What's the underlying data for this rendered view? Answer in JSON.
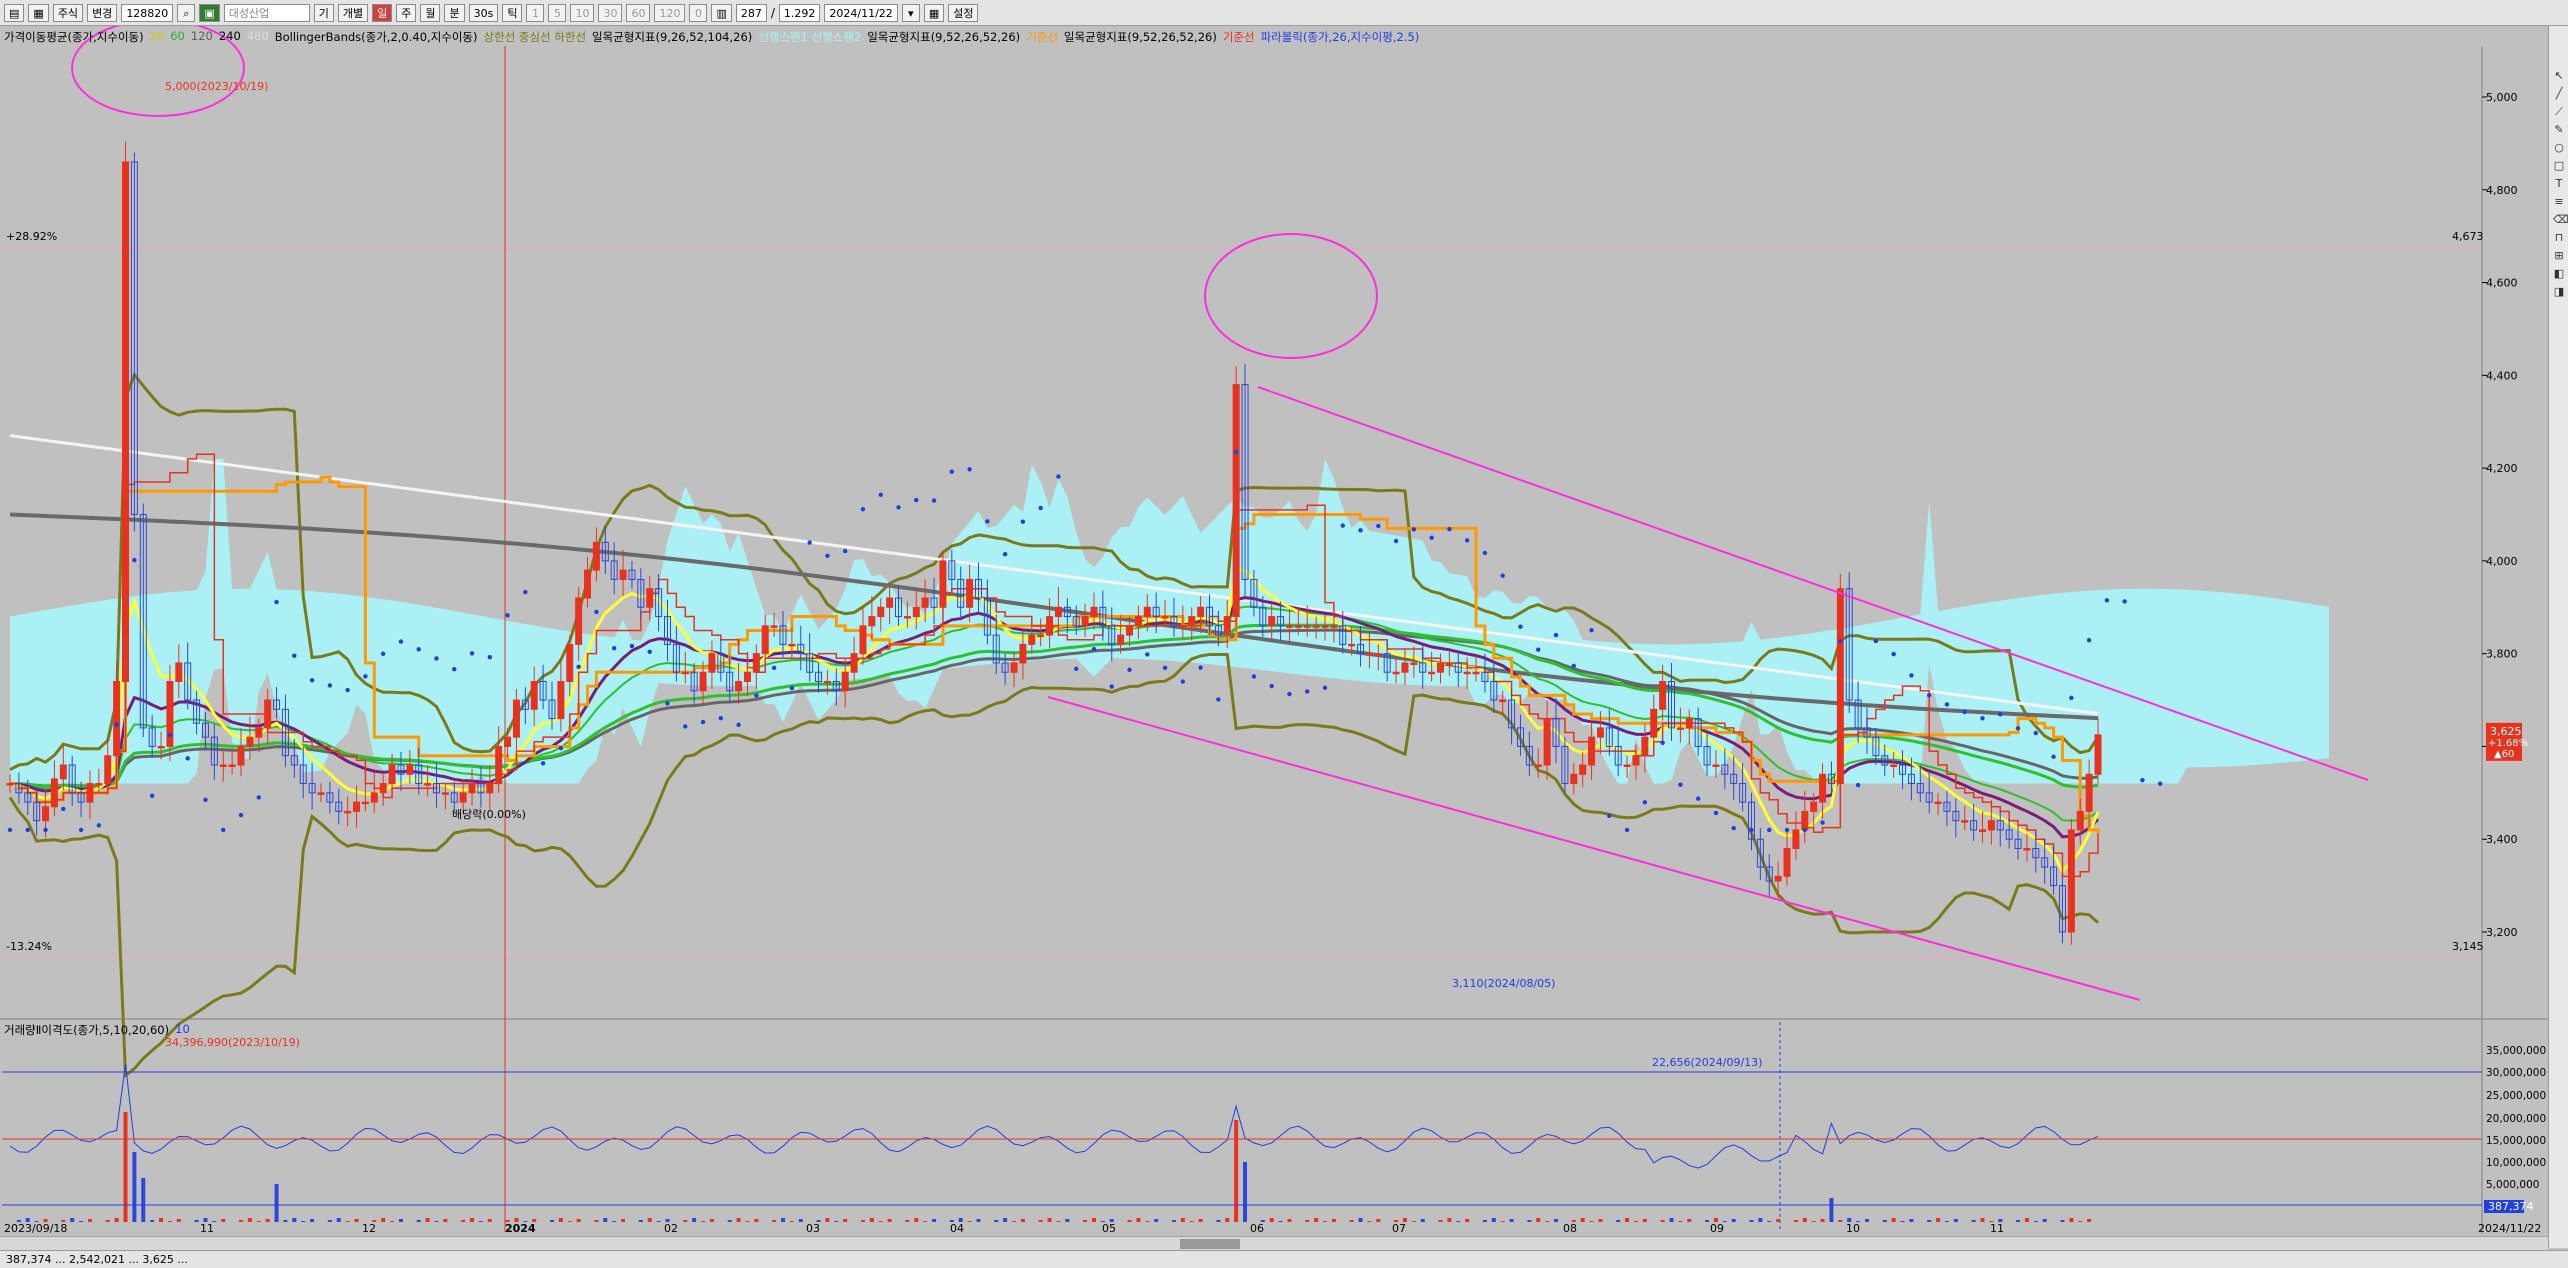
{
  "toolbar": {
    "market": "주식",
    "change": "변경",
    "code": "128820",
    "stock_name": "대성산업",
    "periods": [
      "기",
      "개별",
      "일",
      "주",
      "월",
      "분",
      "30s",
      "틱"
    ],
    "minute_opts": [
      "1",
      "5",
      "10",
      "30",
      "60",
      "120",
      "0"
    ],
    "count": "287",
    "ratio": "1.292",
    "date": "2024/11/22",
    "settings": "설정"
  },
  "legend": {
    "ma_name": "가격이동평균(종가,지수이동)",
    "ma_periods": [
      "20",
      "60",
      "120",
      "240",
      "480"
    ],
    "bb_name": "BollingerBands(종가,2,0.40,지수이동)",
    "bb_lines": "상한선 중심선 하한선",
    "ichimoku1": "일목균형지표(9,26,52,104,26)",
    "ichimoku_lines": "선행스팬1 선행스팬2",
    "ichimoku2": "일목균형지표(9,52,26,52,26)",
    "ichimoku_base": "기준선",
    "ichimoku3": "일목균형지표(9,52,26,52,26)",
    "ichimoku3_base": "기준선",
    "parabolic": "파라볼릭(종가,26,지수이평,2.5)"
  },
  "vol_legend": {
    "name": "거래량Ⅱ이격도(종가,5,10,20,60)",
    "extra": "10"
  },
  "chart_data": {
    "type": "candlestick",
    "x_axis_labels": [
      "2023/09/18",
      "11",
      "12",
      "2024",
      "02",
      "03",
      "04",
      "05",
      "06",
      "07",
      "08",
      "09",
      "10",
      "11",
      "2024/11/22"
    ],
    "y_ticks": [
      3200,
      3400,
      3600,
      3800,
      4000,
      4200,
      4400,
      4600,
      4800,
      5000
    ],
    "ylim": [
      3040,
      5080
    ],
    "current_price": {
      "value": "3,625",
      "change": "+1.68%",
      "delta": "▲60"
    },
    "high_label": "5,000(2023/10/19)",
    "low_label": "3,110(2024/08/05)",
    "upper_pct_label": "+28.92%",
    "upper_pct_value": "4,673",
    "lower_pct_label": "-13.24%",
    "lower_pct_value": "3,145",
    "dividend_label": "배당락(0.00%)",
    "closes": [
      3520,
      3500,
      3480,
      3440,
      3470,
      3530,
      3560,
      3500,
      3480,
      3520,
      3520,
      3580,
      3740,
      4860,
      4100,
      3640,
      3600,
      3600,
      3740,
      3780,
      3700,
      3650,
      3620,
      3560,
      3560,
      3560,
      3600,
      3620,
      3640,
      3700,
      3680,
      3580,
      3560,
      3520,
      3500,
      3500,
      3480,
      3460,
      3460,
      3480,
      3480,
      3500,
      3520,
      3560,
      3540,
      3560,
      3520,
      3520,
      3500,
      3500,
      3480,
      3500,
      3520,
      3500,
      3520,
      3600,
      3620,
      3700,
      3680,
      3740,
      3700,
      3660,
      3740,
      3820,
      3920,
      3980,
      4040,
      4000,
      3960,
      3980,
      3960,
      3900,
      3940,
      3880,
      3820,
      3760,
      3760,
      3720,
      3760,
      3800,
      3760,
      3720,
      3740,
      3760,
      3800,
      3860,
      3860,
      3820,
      3820,
      3800,
      3760,
      3740,
      3740,
      3720,
      3760,
      3800,
      3860,
      3880,
      3900,
      3920,
      3880,
      3880,
      3900,
      3920,
      3900,
      4000,
      3960,
      3900,
      3960,
      3920,
      3840,
      3780,
      3760,
      3780,
      3820,
      3840,
      3840,
      3880,
      3900,
      3880,
      3860,
      3880,
      3900,
      3860,
      3820,
      3840,
      3860,
      3880,
      3900,
      3880,
      3880,
      3860,
      3860,
      3880,
      3900,
      3860,
      3840,
      3880,
      4380,
      3960,
      3900,
      3860,
      3880,
      3860,
      3860,
      3860,
      3860,
      3860,
      3860,
      3860,
      3820,
      3820,
      3800,
      3800,
      3800,
      3760,
      3760,
      3780,
      3780,
      3760,
      3760,
      3780,
      3780,
      3760,
      3760,
      3760,
      3740,
      3700,
      3700,
      3640,
      3600,
      3560,
      3560,
      3660,
      3600,
      3520,
      3540,
      3560,
      3620,
      3640,
      3600,
      3560,
      3560,
      3580,
      3620,
      3680,
      3740,
      3640,
      3640,
      3660,
      3600,
      3560,
      3560,
      3540,
      3520,
      3480,
      3400,
      3340,
      3310,
      3320,
      3380,
      3420,
      3460,
      3480,
      3540,
      3520,
      3940,
      3700,
      3640,
      3620,
      3580,
      3560,
      3560,
      3540,
      3520,
      3500,
      3480,
      3480,
      3460,
      3440,
      3440,
      3420,
      3420,
      3440,
      3420,
      3400,
      3380,
      3380,
      3360,
      3340,
      3300,
      3200,
      3420,
      3460,
      3540,
      3625
    ],
    "volume_peak_label": "34,396,990(2023/10/19)",
    "oscillator_label": "22,656(2024/09/13)",
    "volume_ticks": [
      "35,000,000",
      "30,000,000",
      "25,000,000",
      "20,000,000",
      "15,000,000",
      "10,000,000",
      "5,000,000"
    ],
    "current_volume": "387,374",
    "ichimoku_cloud_color": "#aaf2f8",
    "colors": {
      "up": "#e8321e",
      "down": "#2b48d8",
      "ma20": "#ffff33",
      "ma60": "#7a1d7a",
      "ma120": "#2fbf2f",
      "ma240": "#6a6a6a",
      "ma480": "#000000",
      "bollinger": "#7a7a1a",
      "baseline": "#ff9900",
      "parabolic": "#1f3fe0",
      "trendline": "#ff2ddd"
    }
  },
  "statusbar": {
    "text": "387,374 ... 2,542,021 ... 3,625 ..."
  }
}
